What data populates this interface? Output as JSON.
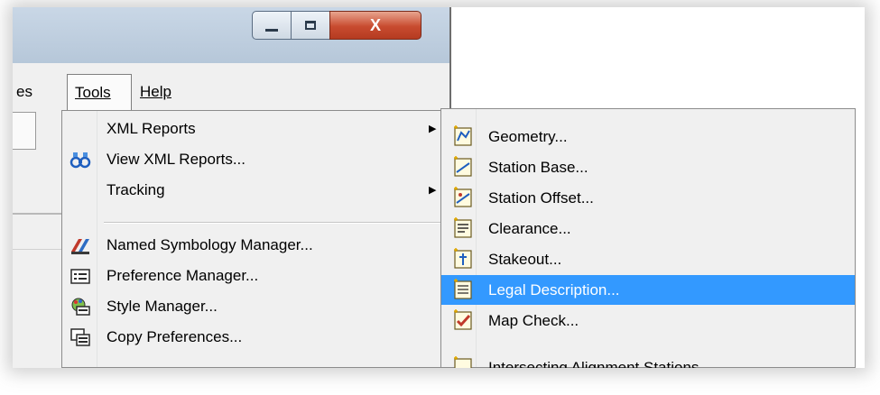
{
  "menubar": {
    "partial_label": "es",
    "tools_label": "Tools",
    "help_label": "Help"
  },
  "window": {
    "close_glyph": "X"
  },
  "tools_menu": {
    "items": [
      {
        "label": "XML Reports",
        "has_submenu": true
      },
      {
        "label": "View XML Reports...",
        "icon": "view-xml-reports-icon"
      },
      {
        "label": "Tracking",
        "has_submenu": true
      },
      {
        "label": "Named Symbology Manager...",
        "icon": "symbology-icon"
      },
      {
        "label": "Preference Manager...",
        "icon": "preference-icon"
      },
      {
        "label": "Style Manager...",
        "icon": "style-icon"
      },
      {
        "label": "Copy Preferences...",
        "icon": "copy-preferences-icon"
      }
    ],
    "submenu_arrow": "▶"
  },
  "xml_reports_submenu": {
    "items": [
      {
        "label": "Geometry..."
      },
      {
        "label": "Station Base..."
      },
      {
        "label": "Station Offset..."
      },
      {
        "label": "Clearance..."
      },
      {
        "label": "Stakeout..."
      },
      {
        "label": "Legal Description...",
        "highlighted": true
      },
      {
        "label": "Map Check..."
      },
      {
        "label": "Intersecting Alignment Stations"
      }
    ],
    "highlight_color": "#3399ff"
  }
}
